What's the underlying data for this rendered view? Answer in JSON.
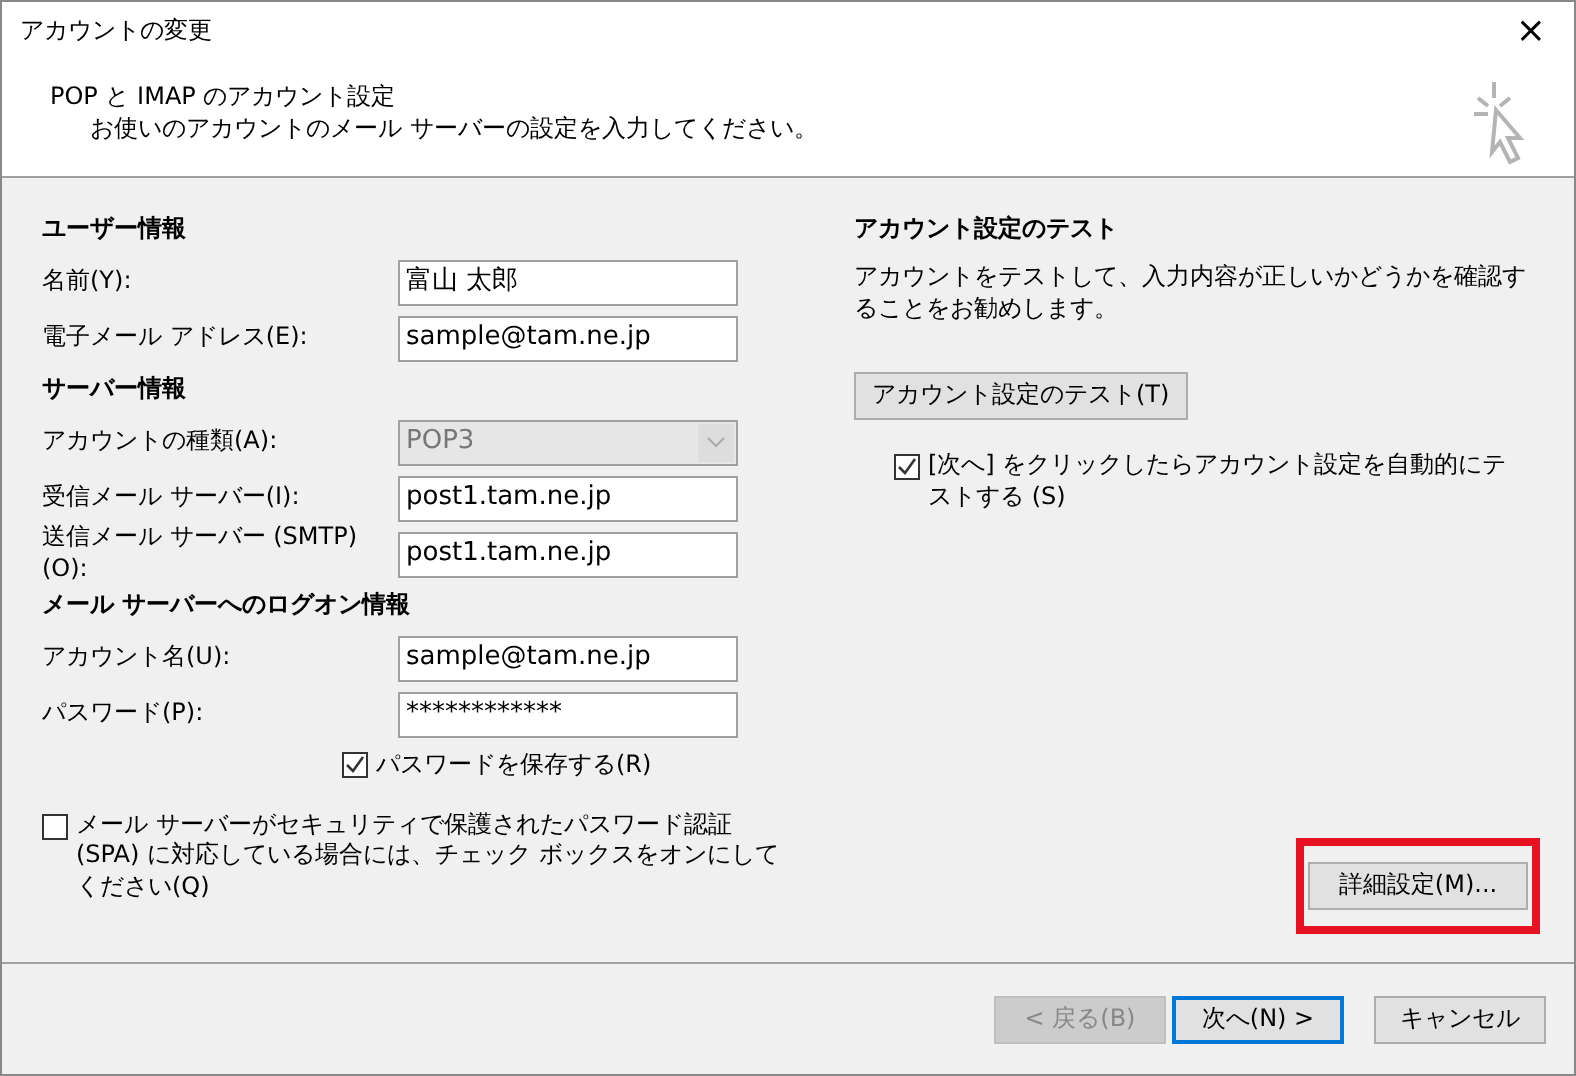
{
  "window": {
    "title": "アカウントの変更",
    "close": "×"
  },
  "header": {
    "title": "POP と IMAP のアカウント設定",
    "subtitle": "お使いのアカウントのメール サーバーの設定を入力してください。"
  },
  "left_sections": [
    {
      "heading": "ユーザー情報",
      "fields": [
        {
          "kind": "text",
          "label": "名前(Y):",
          "value": "富山  太郎",
          "disabled": false
        },
        {
          "kind": "text",
          "label": "電子メール アドレス(E):",
          "value": "sample@tam.ne.jp",
          "disabled": false
        }
      ]
    },
    {
      "heading": "サーバー情報",
      "fields": [
        {
          "kind": "select",
          "label": "アカウントの種類(A):",
          "value": "POP3",
          "disabled": true
        },
        {
          "kind": "text",
          "label": "受信メール サーバー(I):",
          "value": "post1.tam.ne.jp",
          "disabled": false
        },
        {
          "kind": "text",
          "label": "送信メール サーバー (SMTP)(O):",
          "value": "post1.tam.ne.jp",
          "disabled": false
        }
      ]
    },
    {
      "heading": "メール サーバーへのログオン情報",
      "fields": [
        {
          "kind": "text",
          "label": "アカウント名(U):",
          "value": "sample@tam.ne.jp",
          "disabled": false
        },
        {
          "kind": "text",
          "label": "パスワード(P):",
          "value": "************",
          "disabled": false
        }
      ]
    }
  ],
  "save_password": {
    "label": "パスワードを保存する(R)",
    "checked": true
  },
  "spa": {
    "label": "メール サーバーがセキュリティで保護されたパスワード認証 (SPA) に対応している場合には、チェック ボックスをオンにしてください(Q)",
    "checked": false
  },
  "test": {
    "heading": "アカウント設定のテスト",
    "description": "アカウントをテストして、入力内容が正しいかどうかを確認することをお勧めします。",
    "button": "アカウント設定のテスト(T)",
    "auto_test": {
      "label": "[次へ] をクリックしたらアカウント設定を自動的にテストする (S)",
      "checked": true
    }
  },
  "advanced_button": {
    "label": "詳細設定(M)...",
    "highlighted": true
  },
  "footer_buttons": [
    {
      "label": "< 戻る(B)",
      "disabled": true,
      "default": false
    },
    {
      "label": "次へ(N) >",
      "disabled": false,
      "default": true
    },
    {
      "label": "キャンセル",
      "disabled": false,
      "default": false
    }
  ]
}
